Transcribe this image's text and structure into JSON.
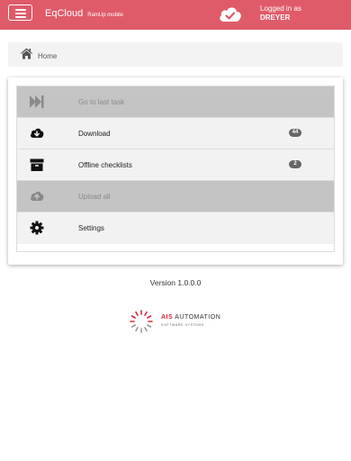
{
  "header": {
    "app_name": "EqCloud",
    "app_subtitle": "RamUp mobile",
    "login_label": "Logged in as",
    "username": "DREYER",
    "sync_status_icon": "cloud-check-icon"
  },
  "breadcrumb": {
    "icon": "home-icon",
    "label": "Home"
  },
  "menu": {
    "items": [
      {
        "label": "Go to last task",
        "icon": "fast-forward-icon",
        "disabled": true,
        "badge": ""
      },
      {
        "label": "Download",
        "icon": "cloud-download-icon",
        "disabled": false,
        "badge": "44"
      },
      {
        "label": "Offline checklists",
        "icon": "archive-box-icon",
        "disabled": false,
        "badge": "2"
      },
      {
        "label": "Upload all",
        "icon": "cloud-upload-icon",
        "disabled": true,
        "badge": ""
      },
      {
        "label": "Settings",
        "icon": "gear-icon",
        "disabled": false,
        "badge": ""
      }
    ]
  },
  "footer": {
    "version": "Version 1.0.0.0",
    "logo_brand": "AIS",
    "logo_text": "AUTOMATION",
    "logo_tagline": "SOFTWARE SYSTEME"
  },
  "colors": {
    "header_bg": "#df5b6a",
    "disabled_row_bg": "#c4c4c4",
    "row_bg": "#f2f2f2",
    "badge_bg": "#666666",
    "logo_red": "#d2283c"
  }
}
